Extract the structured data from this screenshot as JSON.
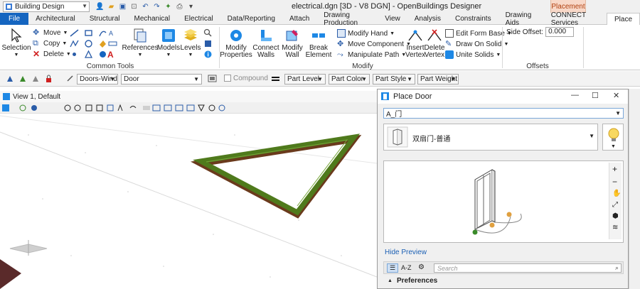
{
  "workspace": {
    "selected": "Building Design"
  },
  "window": {
    "title": "electrical.dgn [3D - V8 DGN] - OpenBuildings Designer",
    "context_tab": "Placement"
  },
  "tabs": [
    "File",
    "Architectural",
    "Structural",
    "Mechanical",
    "Electrical",
    "Data/Reporting",
    "Attach",
    "Drawing Production",
    "View",
    "Analysis",
    "Constraints",
    "Drawing Aids",
    "CONNECT Services",
    "Place"
  ],
  "ribbon": {
    "common_tools": {
      "label": "Common Tools",
      "selection": "Selection",
      "move": "Move",
      "copy": "Copy",
      "delete": "Delete",
      "references": "References",
      "models": "Models",
      "levels": "Levels"
    },
    "modify": {
      "label": "Modify",
      "modify_properties": [
        "Modify",
        "Properties"
      ],
      "connect_walls": [
        "Connect",
        "Walls"
      ],
      "modify_wall": [
        "Modify",
        "Wall"
      ],
      "break_element": [
        "Break",
        "Element"
      ],
      "modify_hand": "Modify Hand",
      "move_component": "Move Component",
      "manipulate_path": "Manipulate Path",
      "insert_vertex": [
        "Insert",
        "Vertex"
      ],
      "delete_vertex": [
        "Delete",
        "Vertex"
      ],
      "edit_form_base": "Edit Form Base",
      "draw_on_solid": "Draw On Solid",
      "unite_solids": "Unite Solids"
    },
    "offsets": {
      "label": "Offsets",
      "side_offset_label": "Side Offset:",
      "side_offset_value": "0.000"
    }
  },
  "attribute_bar": {
    "family": "Doors-Wind",
    "part": "Door",
    "compound_label": "Compound",
    "part_level": "Part Level",
    "part_color": "Part Color",
    "part_style": "Part Style",
    "part_weight": "Part Weight"
  },
  "view": {
    "title": "View 1, Default"
  },
  "place_door": {
    "title": "Place Door",
    "catalog": "A_门",
    "door_type": "双扇门-普通",
    "hide_preview": "Hide Preview",
    "sort_az": "A-Z",
    "search_placeholder": "Search",
    "preferences": "Preferences"
  },
  "colors": {
    "file_tab": "#1565c0",
    "context_tab_bg": "#f8d8c8",
    "wall_green": "#4f7a1c",
    "wall_brown": "#6a3a1c"
  }
}
